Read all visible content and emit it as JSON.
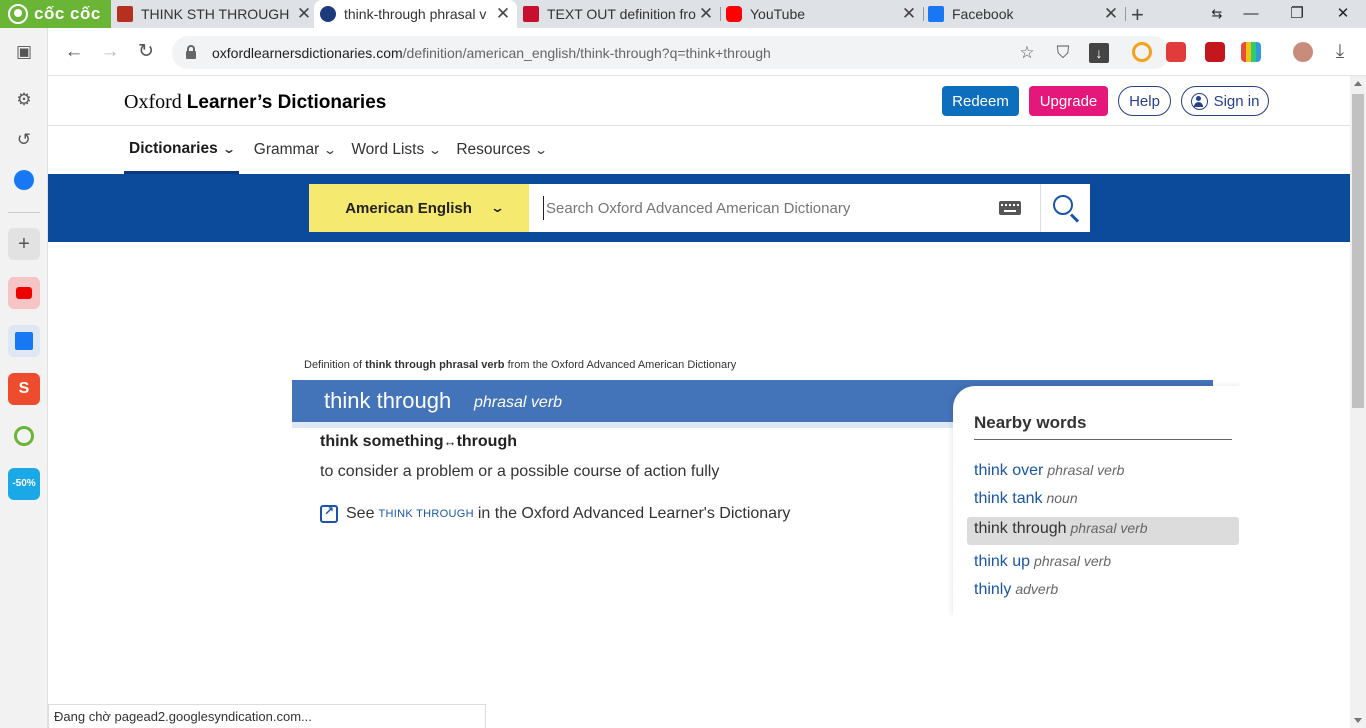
{
  "browser": {
    "brand": "cốc cốc",
    "tabs": [
      {
        "title": "THINK STH THROUGH |"
      },
      {
        "title": "think-through phrasal v"
      },
      {
        "title": "TEXT OUT definition fro"
      },
      {
        "title": "YouTube"
      },
      {
        "title": "Facebook"
      }
    ],
    "url_host": "oxfordlearnersdictionaries.com",
    "url_path": "/definition/american_english/think-through?q=think+through",
    "status": "Đang chờ pagead2.googlesyndication.com..."
  },
  "colors": {
    "tab_strip": "#dee1e6",
    "brand_green": "#6ab535",
    "oxford_blue_band": "#0c4a9c",
    "entry_bar": "#4373b8",
    "redeem": "#0d6ebd",
    "upgrade": "#e6177b",
    "dict_select": "#f5e96f",
    "link": "#1a56a8"
  },
  "site": {
    "logo_serif": "Oxford",
    "logo_bold": "Learner’s Dictionaries",
    "redeem": "Redeem",
    "upgrade": "Upgrade",
    "help": "Help",
    "signin": "Sign in",
    "nav": [
      "Dictionaries",
      "Grammar",
      "Word Lists",
      "Resources"
    ],
    "dictionary_select": "American English",
    "search_placeholder": "Search Oxford Advanced American Dictionary"
  },
  "entry": {
    "source_prefix": "Definition of",
    "source_term": "think through phrasal verb",
    "source_suffix": "from the Oxford Advanced American Dictionary",
    "headword": "think through",
    "pos": "phrasal verb",
    "usage_a": "think something",
    "usage_arrow": "↔",
    "usage_b": "through",
    "definition": "to consider a problem or a possible course of action fully",
    "see_prefix": "See",
    "see_term": "THINK THROUGH",
    "see_suffix": "in the Oxford Advanced Learner's Dictionary"
  },
  "nearby": {
    "title": "Nearby words",
    "items": [
      {
        "word": "think over",
        "pos": "phrasal verb"
      },
      {
        "word": "think tank",
        "pos": "noun"
      },
      {
        "word": "think through",
        "pos": "phrasal verb",
        "selected": true
      },
      {
        "word": "think up",
        "pos": "phrasal verb"
      },
      {
        "word": "thinly",
        "pos": "adverb"
      }
    ]
  }
}
